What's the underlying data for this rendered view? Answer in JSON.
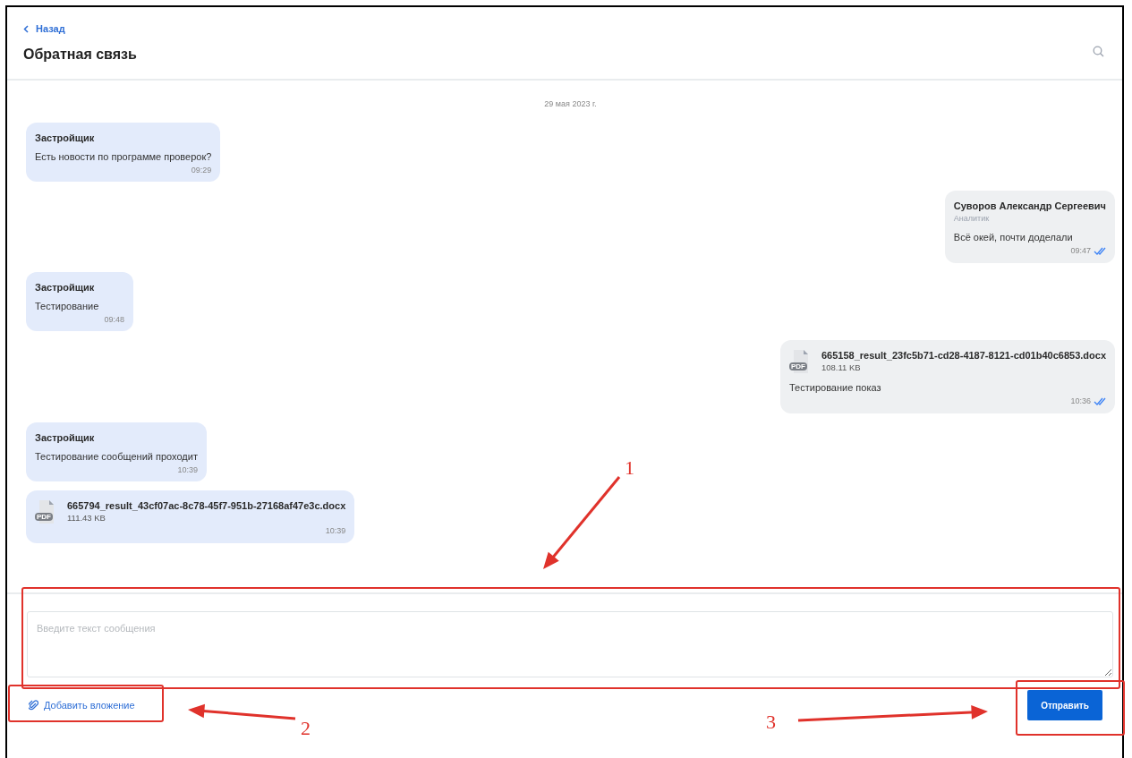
{
  "header": {
    "back_link": "Назад",
    "title": "Обратная связь"
  },
  "date_divider": "29 мая 2023 г.",
  "messages": [
    {
      "kind": "text",
      "outgoing": false,
      "author": "Застройщик",
      "text": "Есть новости по программе проверок?",
      "time": "09:29"
    },
    {
      "kind": "text",
      "outgoing": true,
      "author": "Суворов Александр Сергеевич",
      "role": "Аналитик",
      "text": "Всё окей, почти доделали",
      "time": "09:47",
      "read": true
    },
    {
      "kind": "text",
      "outgoing": false,
      "author": "Застройщик",
      "text": "Тестирование",
      "time": "09:48"
    },
    {
      "kind": "file",
      "outgoing": true,
      "file_badge": "PDF",
      "file_name": "665158_result_23fc5b71-cd28-4187-8121-cd01b40c6853.docx",
      "file_size": "108.11 KB",
      "text": "Тестирование показ",
      "time": "10:36",
      "read": true
    },
    {
      "kind": "text",
      "outgoing": false,
      "author": "Застройщик",
      "text": "Тестирование сообщений проходит",
      "time": "10:39"
    },
    {
      "kind": "file",
      "outgoing": false,
      "file_badge": "PDF",
      "file_name": "665794_result_43cf07ac-8c78-45f7-951b-27168af47e3c.docx",
      "file_size": "111.43 KB",
      "time": "10:39"
    }
  ],
  "composer": {
    "placeholder": "Введите текст сообщения",
    "attach_button": "Добавить вложение",
    "send_button": "Отправить"
  },
  "annotations": [
    {
      "label": "1"
    },
    {
      "label": "2"
    },
    {
      "label": "3"
    }
  ]
}
